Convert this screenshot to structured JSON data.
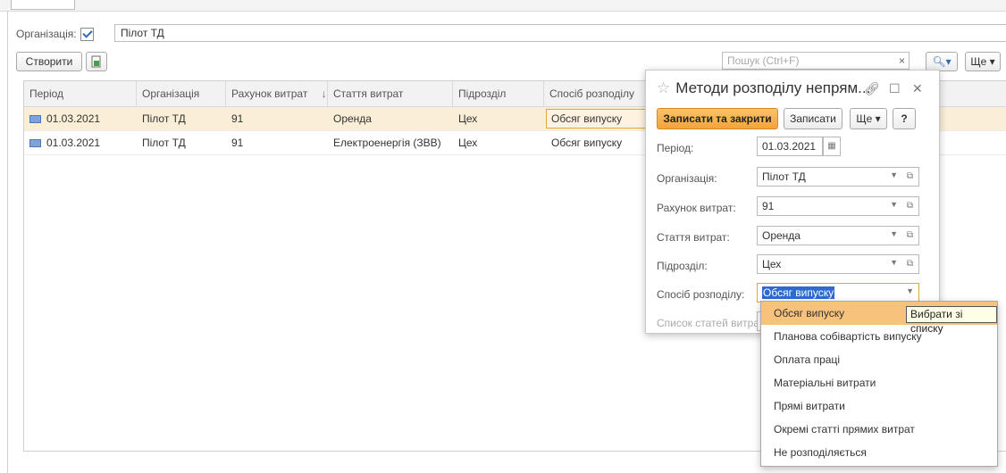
{
  "filter": {
    "label": "Організація:",
    "value": "Пілот ТД"
  },
  "toolbar": {
    "create_label": "Створити",
    "search_placeholder": "Пошук (Ctrl+F)",
    "clear": "×",
    "more_label": "Ще ▾"
  },
  "table": {
    "columns": [
      "Період",
      "Організація",
      "Рахунок витрат",
      "Стаття витрат",
      "Підрозділ",
      "Спосіб розподілу"
    ],
    "sort_indicator": "↓",
    "rows": [
      [
        "01.03.2021",
        "Пілот ТД",
        "91",
        "Оренда",
        "Цех",
        "Обсяг випуску"
      ],
      [
        "01.03.2021",
        "Пілот ТД",
        "91",
        "Електроенергія (ЗВВ)",
        "Цех",
        "Обсяг випуску"
      ]
    ]
  },
  "modal": {
    "title": "Методи розподілу непрям...",
    "save_close_label": "Записати та закрити",
    "save_label": "Записати",
    "more_label": "Ще ▾",
    "help_label": "?",
    "fields": {
      "period_label": "Період:",
      "period_value": "01.03.2021",
      "org_label": "Організація:",
      "org_value": "Пілот ТД",
      "account_label": "Рахунок витрат:",
      "account_value": "91",
      "item_label": "Стаття витрат:",
      "item_value": "Оренда",
      "dept_label": "Підрозділ:",
      "dept_value": "Цех",
      "method_label": "Спосіб розподілу:",
      "method_value": "Обсяг випуску",
      "list_label": "Список статей витрат:"
    }
  },
  "dropdown": {
    "tooltip": "Вибрати зі списку",
    "items": [
      "Обсяг випуску",
      "Планова собівартість випуску",
      "Оплата праці",
      "Матеріальні витрати",
      "Прямі витрати",
      "Окремі статті прямих витрат",
      "Не розподіляється"
    ]
  },
  "colors": {
    "accent": "#f6a833",
    "selection": "#fbeed7",
    "highlight": "#f6c27c"
  }
}
